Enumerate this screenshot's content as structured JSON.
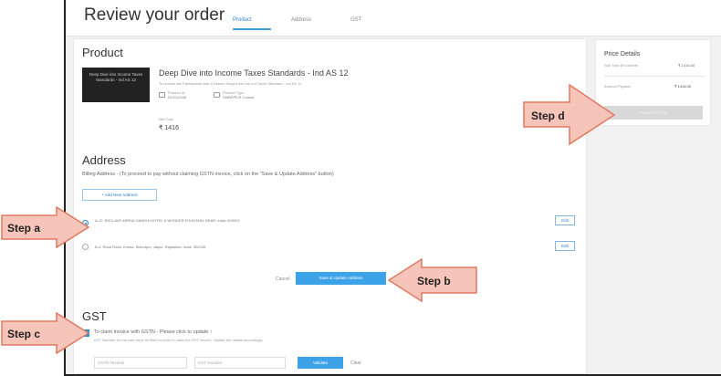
{
  "header": {
    "title": "Review your order",
    "tabs": [
      {
        "label": "Product",
        "active": true
      },
      {
        "label": "Address",
        "active": false
      },
      {
        "label": "GST",
        "active": false
      }
    ]
  },
  "product": {
    "heading": "Product",
    "thumbnail_text": "Deep Dive into Income Taxes Standards - Ind AS 12",
    "name": "Deep Dive into Income Taxes Standards - Ind AS 12",
    "subtitle": "To provide the Participants with a Deeper Insight into the Ind Taxes Standard - Ind AS 12",
    "meta": [
      {
        "label": "Product Id",
        "value": "DCG12345"
      },
      {
        "label": "Product Type",
        "value": "ONRE/PLR Course"
      }
    ],
    "price_label": "Net Cost",
    "price": "₹ 1416"
  },
  "address": {
    "heading": "Address",
    "note": "Billing Address - (To proceed to pay without claiming GSTN invoice, click on the \"Save & Update Address\" button)",
    "add_button": "+ Add New Address",
    "options": [
      {
        "text": "A-12, ENCLAVE ARENA GANDHI HOTEL & WONDER FOUNTAIN, NEAR, India, 400001",
        "selected": true,
        "edit": "Edit"
      },
      {
        "text": "B-4, Rural Road, Kheda, Kishorpur, Jaipur, Rajasthan, India, 302026",
        "selected": false,
        "edit": "Edit"
      }
    ],
    "cancel": "Cancel",
    "save_button": "Save & Update Address"
  },
  "gst": {
    "heading": "GST",
    "checkbox_label": "To claim invoice with GSTN - Please click to update ↑",
    "checkbox_sub": "GST Number for the user must be filled in order to claim the GST invoice. Update the details accordingly.",
    "inputs": [
      {
        "placeholder": "GSTN Number"
      },
      {
        "placeholder": "GST Number"
      }
    ],
    "submit": "Validate",
    "extra": "Clear"
  },
  "price_details": {
    "heading": "Price Details",
    "rows": [
      {
        "label": "Sub Total (Exclusive)",
        "value": "₹ 1416.00"
      },
      {
        "label": "Amount Payable",
        "value": "₹ 1416.00"
      }
    ],
    "button": "Proceed to Pay"
  },
  "callouts": [
    "Step a",
    "Step b",
    "Step c",
    "Step d"
  ],
  "colors": {
    "accent": "#3da3e8",
    "arrow_fill": "#f6c4b8",
    "arrow_stroke": "#e07a62"
  }
}
